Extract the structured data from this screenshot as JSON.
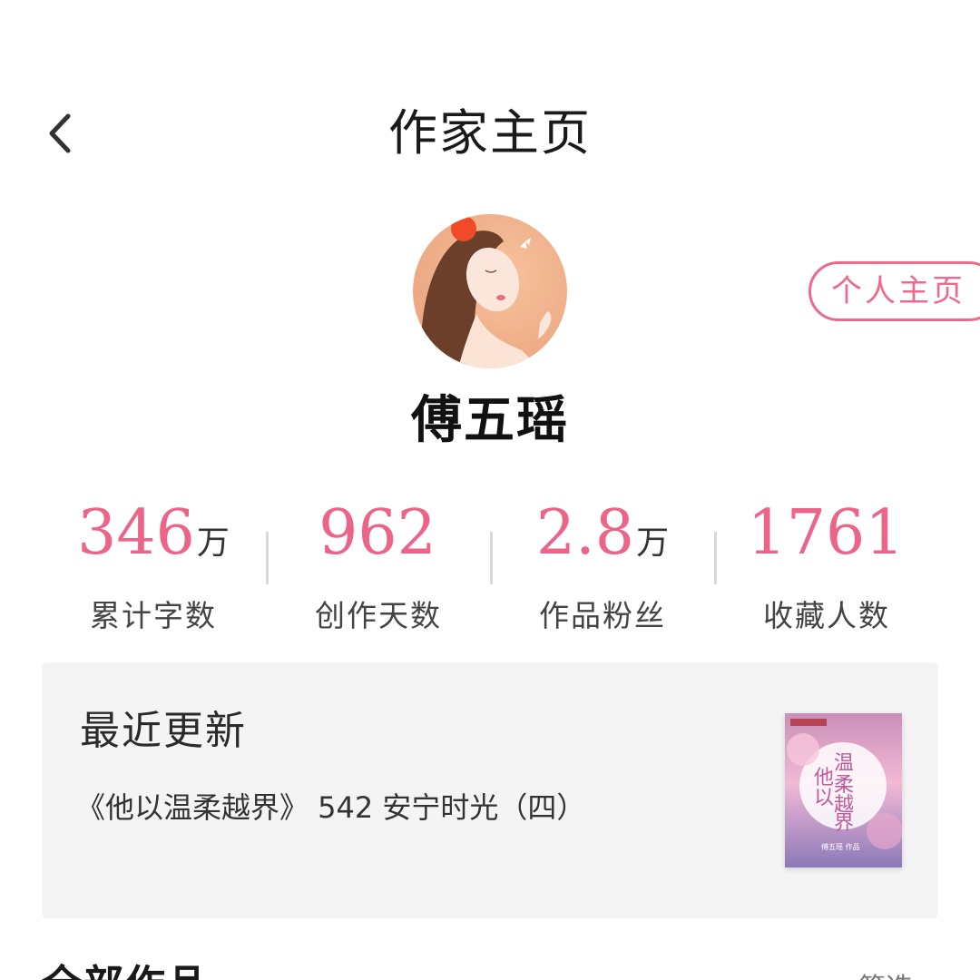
{
  "header": {
    "title": "作家主页",
    "back_icon": "chevron-left-icon"
  },
  "author": {
    "name": "傅五瑶",
    "home_button": "个人主页"
  },
  "stats": [
    {
      "value": "346",
      "unit": "万",
      "label": "累计字数"
    },
    {
      "value": "962",
      "unit": "",
      "label": "创作天数"
    },
    {
      "value": "2.8",
      "unit": "万",
      "label": "作品粉丝"
    },
    {
      "value": "1761",
      "unit": "",
      "label": "收藏人数"
    }
  ],
  "recent": {
    "title": "最近更新",
    "text": "《他以温柔越界》 542 安宁时光（四）",
    "cover_title": "他以温柔越界",
    "cover_author": "傅五瑶 作品"
  },
  "works": {
    "title": "全部作品",
    "more": "筛选"
  },
  "colors": {
    "accent": "#ec6487",
    "card_bg": "#f4f4f4"
  }
}
